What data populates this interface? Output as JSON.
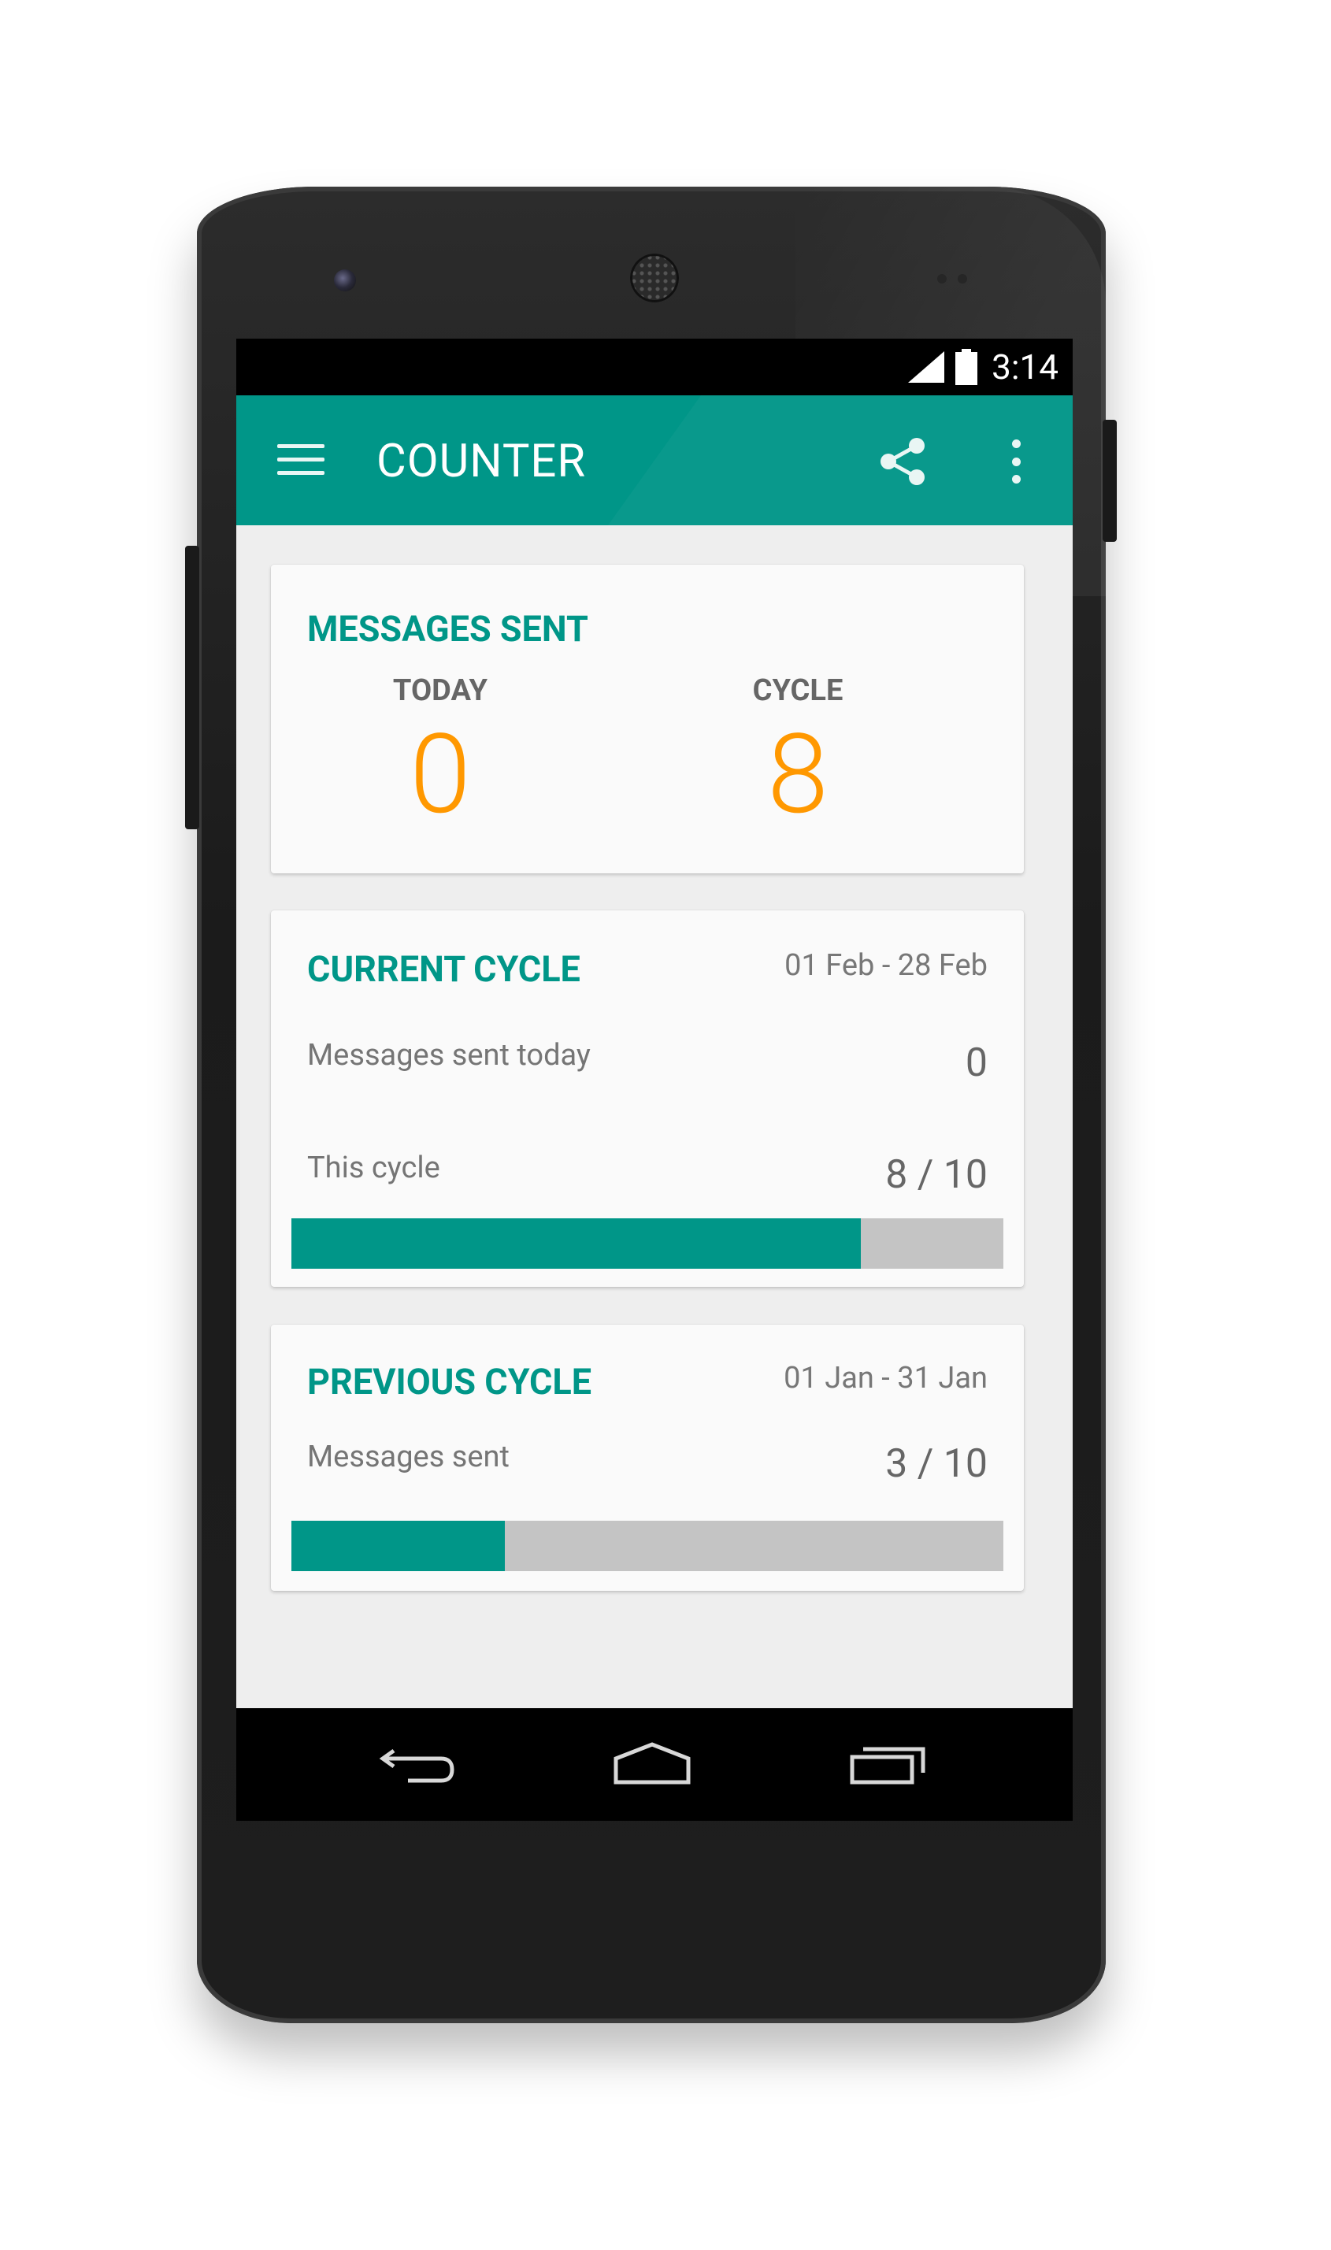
{
  "status_bar": {
    "time": "3:14"
  },
  "toolbar": {
    "title": "COUNTER",
    "icons": [
      "menu-icon",
      "share-icon",
      "more-vert-icon"
    ]
  },
  "messages_sent": {
    "title": "MESSAGES SENT",
    "today_label": "TODAY",
    "today_value": "0",
    "cycle_label": "CYCLE",
    "cycle_value": "8"
  },
  "current_cycle": {
    "title": "CURRENT CYCLE",
    "range": "01 Feb - 28 Feb",
    "today_label": "Messages sent today",
    "today_value": "0",
    "cycle_label": "This cycle",
    "cycle_value": "8 / 10",
    "progress": 0.8
  },
  "previous_cycle": {
    "title": "PREVIOUS CYCLE",
    "range": "01 Jan - 31 Jan",
    "sent_label": "Messages sent",
    "sent_value": "3 / 10",
    "progress": 0.3
  },
  "colors": {
    "accent": "#009688",
    "highlight": "#ff9800",
    "bar_track": "#c4c4c4"
  },
  "nav_bar": {
    "icons": [
      "back-icon",
      "home-icon",
      "recents-icon"
    ]
  }
}
